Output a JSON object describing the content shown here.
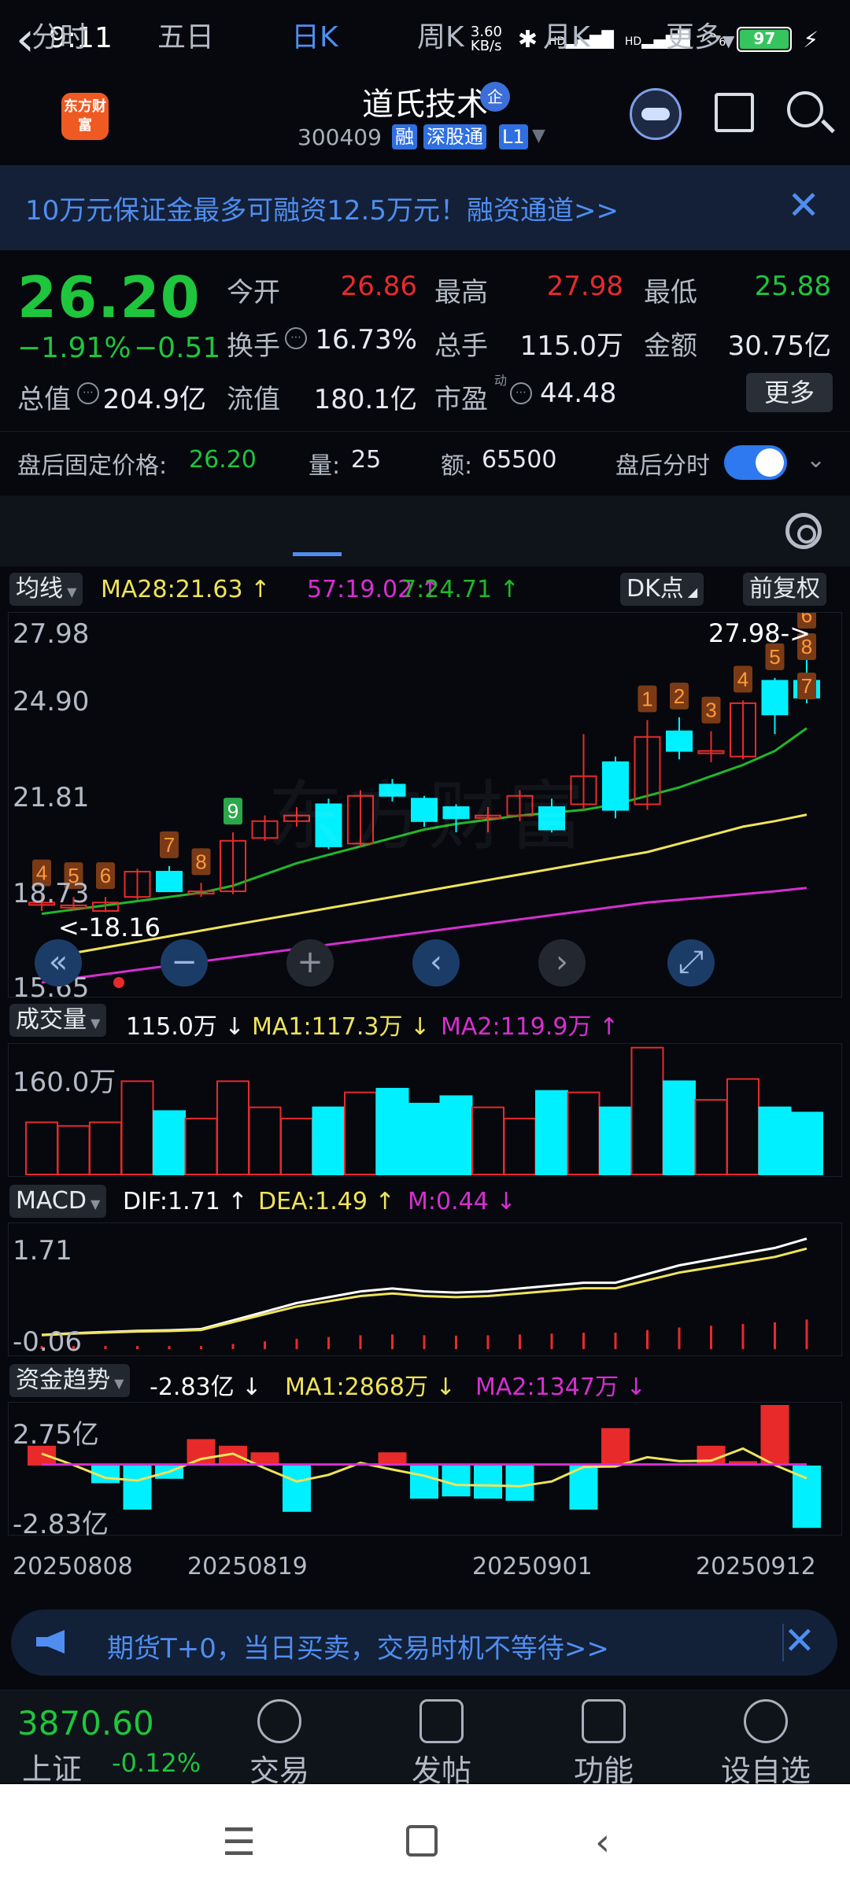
{
  "status_bar": {
    "time": "9:11",
    "net_speed": "3.60 KB/s",
    "signal_1": "HD",
    "signal_2": "HD",
    "wifi": "6",
    "battery": "97"
  },
  "header": {
    "logo": "东方财富",
    "title": "道氏技术",
    "badge": "企",
    "code": "300409",
    "tags": [
      "融",
      "深股通",
      "L1"
    ]
  },
  "banner": {
    "text": "10万元保证金最多可融资12.5万元！融资通道>>"
  },
  "quote": {
    "price": "26.20",
    "pct": "−1.91%",
    "chg": "−0.51",
    "open_label": "今开",
    "open": "26.86",
    "high_label": "最高",
    "high": "27.98",
    "low_label": "最低",
    "low": "25.88",
    "turnover_label": "换手",
    "turnover": "16.73%",
    "volume_label": "总手",
    "volume": "115.0万",
    "amount_label": "金额",
    "amount": "30.75亿",
    "mcap_label": "总值",
    "mcap": "204.9亿",
    "float_label": "流值",
    "float": "180.1亿",
    "pe_label": "市盈",
    "pe_sup": "动",
    "pe": "44.48",
    "more": "更多"
  },
  "after_hours": {
    "price_label": "盘后固定价格:",
    "price": "26.20",
    "qty_label": "量:",
    "qty": "25",
    "amt_label": "额:",
    "amt": "65500",
    "split_label": "盘后分时"
  },
  "tabs": [
    "分时",
    "五日",
    "日K",
    "周K",
    "月K",
    "更多"
  ],
  "active_tab": "日K",
  "kline": {
    "ma_dropdown": "均线",
    "ma28": "MA28:21.63 ↑",
    "ma57": "57:19.02 ↑",
    "ma7": "7:24.71 ↑",
    "dk": "DK点",
    "adj": "前复权",
    "y_ticks": [
      "27.98",
      "24.90",
      "21.81",
      "18.73",
      "15.65"
    ],
    "high_note": "27.98->",
    "low_note": "<-18.16",
    "watermark": "东方财富"
  },
  "volume": {
    "label": "成交量",
    "val": "115.0万 ↓",
    "ma1": "MA1:117.3万 ↓",
    "ma2": "MA2:119.9万 ↑",
    "y_tick": "160.0万"
  },
  "macd": {
    "label": "MACD",
    "dif": "DIF:1.71 ↑",
    "dea": "DEA:1.49 ↑",
    "m": "M:0.44 ↓",
    "y_top": "1.71",
    "y_bot": "-0.06"
  },
  "fund": {
    "label": "资金趋势",
    "val": "-2.83亿 ↓",
    "ma1": "MA1:2868万 ↓",
    "ma2": "MA2:1347万 ↓",
    "y_top": "2.75亿",
    "y_bot": "-2.83亿"
  },
  "dates": [
    "20250808",
    "20250819",
    "20250901",
    "20250912"
  ],
  "ad": {
    "text": "期货T+0，当日买卖，交易时机不等待>>"
  },
  "index": {
    "value": "3870.60",
    "name": "上证",
    "chg": "-0.12%"
  },
  "bottom_nav": [
    "交易",
    "发帖",
    "功能",
    "设自选"
  ],
  "colors": {
    "up": "#e82a2a",
    "down": "#00f0ff",
    "green": "#1fc53c",
    "ma_yellow": "#f0e35a",
    "ma_purple": "#d62fd0",
    "ma_green": "#1fb82a",
    "accent": "#4f8ef0"
  },
  "chart_data": {
    "type": "candlestick",
    "ylim": [
      15.65,
      27.98
    ],
    "candles": [
      {
        "o": 18.5,
        "c": 18.5,
        "h": 18.8,
        "l": 18.2
      },
      {
        "o": 18.4,
        "c": 18.4,
        "h": 18.7,
        "l": 18.2
      },
      {
        "o": 18.2,
        "c": 18.5,
        "h": 18.7,
        "l": 18.16
      },
      {
        "o": 18.7,
        "c": 19.6,
        "h": 19.7,
        "l": 18.6
      },
      {
        "o": 19.6,
        "c": 18.9,
        "h": 19.8,
        "l": 18.9
      },
      {
        "o": 18.9,
        "c": 18.9,
        "h": 19.2,
        "l": 18.7
      },
      {
        "o": 18.9,
        "c": 20.7,
        "h": 21.0,
        "l": 18.8
      },
      {
        "o": 20.8,
        "c": 21.4,
        "h": 21.6,
        "l": 20.7
      },
      {
        "o": 21.4,
        "c": 21.6,
        "h": 21.9,
        "l": 21.2
      },
      {
        "o": 22.0,
        "c": 20.5,
        "h": 22.2,
        "l": 20.4
      },
      {
        "o": 20.6,
        "c": 22.3,
        "h": 22.5,
        "l": 20.5
      },
      {
        "o": 22.7,
        "c": 22.3,
        "h": 22.9,
        "l": 22.1
      },
      {
        "o": 22.2,
        "c": 21.4,
        "h": 22.3,
        "l": 21.2
      },
      {
        "o": 21.9,
        "c": 21.5,
        "h": 22.0,
        "l": 21.0
      },
      {
        "o": 21.6,
        "c": 21.6,
        "h": 21.9,
        "l": 21.0
      },
      {
        "o": 21.6,
        "c": 22.3,
        "h": 22.5,
        "l": 21.4
      },
      {
        "o": 21.9,
        "c": 21.1,
        "h": 22.2,
        "l": 21.0
      },
      {
        "o": 22.0,
        "c": 23.0,
        "h": 24.5,
        "l": 21.8
      },
      {
        "o": 23.5,
        "c": 21.8,
        "h": 23.7,
        "l": 21.5
      },
      {
        "o": 22.0,
        "c": 24.4,
        "h": 25.0,
        "l": 21.8
      },
      {
        "o": 24.6,
        "c": 23.9,
        "h": 25.1,
        "l": 23.6
      },
      {
        "o": 23.9,
        "c": 23.9,
        "h": 24.6,
        "l": 23.5
      },
      {
        "o": 23.7,
        "c": 25.6,
        "h": 25.7,
        "l": 23.6
      },
      {
        "o": 26.4,
        "c": 25.2,
        "h": 26.5,
        "l": 24.5
      },
      {
        "o": 26.4,
        "c": 25.8,
        "h": 27.98,
        "l": 25.6
      }
    ],
    "ma7": [
      18.1,
      18.25,
      18.4,
      18.55,
      18.7,
      18.85,
      19.1,
      19.5,
      19.9,
      20.2,
      20.5,
      20.8,
      21.1,
      21.3,
      21.45,
      21.6,
      21.7,
      21.8,
      22.0,
      22.3,
      22.6,
      23.0,
      23.4,
      23.9,
      24.71
    ],
    "ma28": [
      16.5,
      16.7,
      16.9,
      17.1,
      17.3,
      17.5,
      17.7,
      17.9,
      18.1,
      18.3,
      18.5,
      18.7,
      18.9,
      19.1,
      19.3,
      19.5,
      19.7,
      19.9,
      20.1,
      20.3,
      20.6,
      20.9,
      21.2,
      21.4,
      21.63
    ],
    "ma57": [
      15.65,
      15.8,
      15.95,
      16.1,
      16.25,
      16.4,
      16.55,
      16.7,
      16.85,
      17.0,
      17.15,
      17.3,
      17.45,
      17.6,
      17.75,
      17.9,
      18.05,
      18.2,
      18.35,
      18.5,
      18.6,
      18.7,
      18.8,
      18.9,
      19.02
    ],
    "marker_labels": [
      "4",
      "5",
      "6",
      "7",
      "8",
      "9",
      "1",
      "2",
      "3",
      "4",
      "5",
      "6",
      "7",
      "8"
    ],
    "volume": [
      70,
      65,
      70,
      125,
      85,
      75,
      125,
      90,
      75,
      90,
      110,
      115,
      95,
      105,
      90,
      75,
      112,
      110,
      90,
      170,
      125,
      100,
      128,
      90,
      83
    ],
    "macd_dif": [
      0.05,
      0.08,
      0.1,
      0.12,
      0.13,
      0.15,
      0.3,
      0.45,
      0.6,
      0.7,
      0.8,
      0.85,
      0.8,
      0.78,
      0.8,
      0.85,
      0.9,
      0.95,
      0.95,
      1.1,
      1.25,
      1.35,
      1.45,
      1.55,
      1.71
    ],
    "fund_flow": [
      0.9,
      0,
      -0.8,
      -2.0,
      -0.6,
      1.2,
      0.9,
      0.6,
      -2.1,
      0,
      0,
      0.6,
      -1.5,
      -1.4,
      -1.5,
      -1.6,
      0,
      -2.0,
      1.7,
      0.1,
      0,
      0.9,
      0.2,
      2.75,
      -2.83
    ]
  }
}
